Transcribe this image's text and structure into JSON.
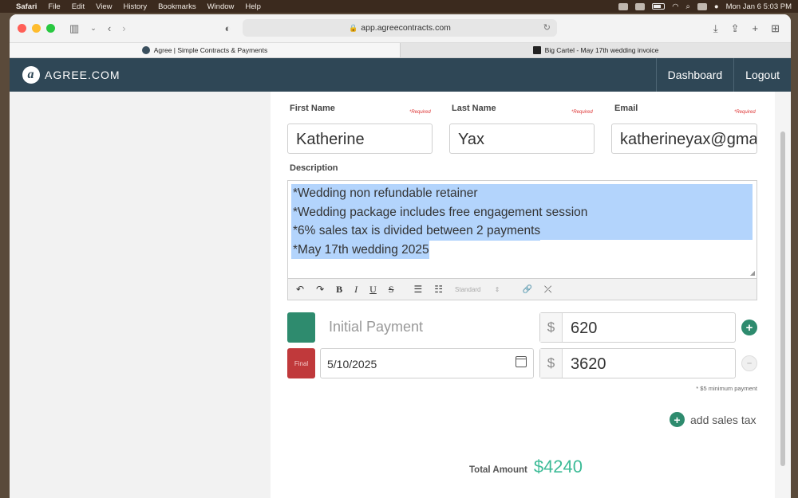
{
  "menubar": {
    "app": "Safari",
    "items": [
      "File",
      "Edit",
      "View",
      "History",
      "Bookmarks",
      "Window",
      "Help"
    ],
    "clock": "Mon Jan 6  5:03 PM"
  },
  "browser": {
    "url": "app.agreecontracts.com",
    "tabs": [
      {
        "label": "Agree | Simple Contracts & Payments",
        "active": true
      },
      {
        "label": "Big Cartel - May 17th wedding invoice",
        "active": false
      }
    ]
  },
  "site": {
    "brand": "AGREE.COM",
    "logo_letter": "a",
    "nav": [
      "Dashboard",
      "Logout"
    ]
  },
  "form": {
    "first_name_label": "First Name",
    "last_name_label": "Last Name",
    "email_label": "Email",
    "required": "*Required",
    "first_name": "Katherine",
    "last_name": "Yax",
    "email": "katherineyax@gma",
    "description_label": "Description",
    "description_lines": [
      "*Wedding non refundable retainer",
      "*Wedding package includes free engagement session",
      "*6% sales tax is divided between 2 payments",
      "*May 17th wedding 2025"
    ],
    "toolbar": {
      "undo": "↶",
      "redo": "↷",
      "bold": "B",
      "italic": "I",
      "underline": "U",
      "strike": "S",
      "bullet_list": "☰",
      "numbered_list": "☷",
      "style": "Standard",
      "link": "🔗",
      "unlink": "⤫"
    }
  },
  "payments": {
    "initial_label": "Initial Payment",
    "currency": "$",
    "initial_amount": "620",
    "final_label": "Final",
    "final_date": "5/10/2025",
    "final_amount": "3620",
    "add": "+",
    "remove": "–",
    "min_note": "* $5 minimum payment",
    "add_tax": "add sales tax",
    "total_label": "Total Amount",
    "total_value": "$4240",
    "colors": {
      "initial_swatch": "#2e8b6e",
      "final_swatch": "#c0393b"
    }
  }
}
